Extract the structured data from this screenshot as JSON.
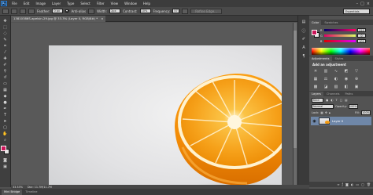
{
  "menubar": {
    "logo": "Ps",
    "items": [
      "File",
      "Edit",
      "Image",
      "Layer",
      "Type",
      "Select",
      "Filter",
      "View",
      "Window",
      "Help"
    ]
  },
  "options": {
    "feather_label": "Feather:",
    "feather_value": "0 px",
    "antialias_label": "Anti-alias",
    "style_label": "Style:",
    "width_label": "Width:",
    "width_value": "2px",
    "contrast_label": "Contrast:",
    "contrast_value": "10%",
    "frequency_label": "Frequency:",
    "frequency_value": "57",
    "refine_edge_label": "Refine Edge...",
    "workspace": "Essentials"
  },
  "document": {
    "tab_title": "13810386S-apelsin-29.jpg @ 33.3% (Layer 0, RGB/8#) *",
    "close": "×"
  },
  "status": {
    "zoom": "33.33%",
    "doc_size": "Doc: 11.7M/11.7M"
  },
  "bottom_tabs": [
    "Mini Bridge",
    "Timeline"
  ],
  "color_panel": {
    "tabs": [
      "Color",
      "Swatches"
    ],
    "channels": [
      {
        "name": "R",
        "value": "222"
      },
      {
        "name": "G",
        "value": "0"
      },
      {
        "name": "B",
        "value": "101"
      }
    ]
  },
  "adjustments_panel": {
    "tabs": [
      "Adjustments",
      "Styles"
    ],
    "title": "Add an adjustment",
    "icons": [
      "sun-icon",
      "levels-icon",
      "curves-icon",
      "exposure-icon",
      "triangle-icon",
      "vibrance-icon",
      "hue-icon",
      "balance-icon",
      "bw-icon",
      "camera-icon",
      "mixer-icon",
      "lookup-icon",
      "invert-icon",
      "posterize-icon",
      "threshold-icon"
    ]
  },
  "layers_panel": {
    "tabs": [
      "Layers",
      "Channels",
      "Paths"
    ],
    "kind": "Kind",
    "blend_mode": "Normal",
    "opacity_label": "Opacity:",
    "opacity_value": "100%",
    "lock_label": "Lock:",
    "fill_label": "Fill:",
    "fill_value": "100%",
    "layer_name": "Layer 0"
  },
  "colors": {
    "foreground": "#cc1559",
    "background": "#e5e5e5",
    "orange_peel": "#f29a12",
    "orange_flesh": "#f7a21b"
  }
}
